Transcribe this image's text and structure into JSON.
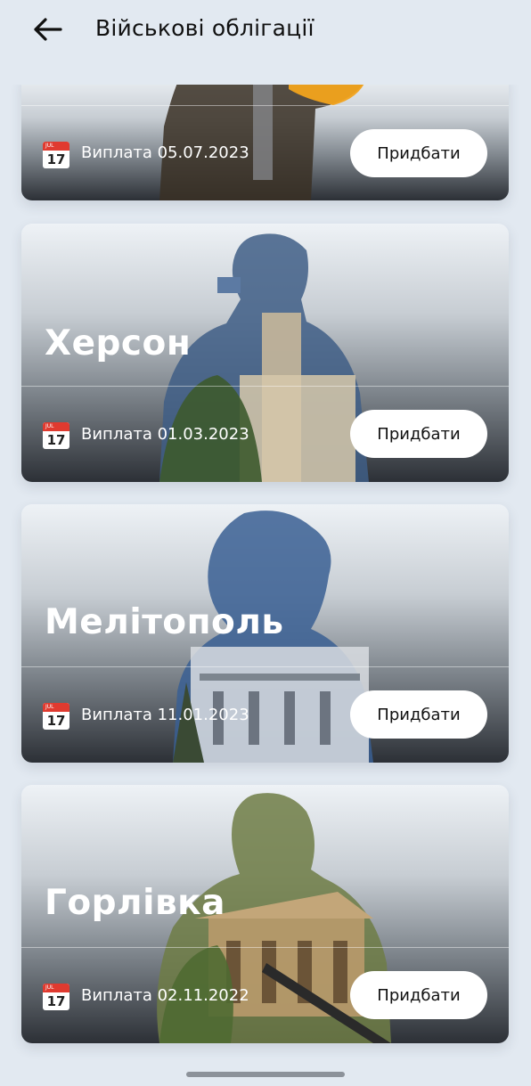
{
  "header": {
    "title": "Військові облігації",
    "back_icon": "arrow-left-icon"
  },
  "cards": [
    {
      "city": "",
      "payout": "Виплата 05.07.2023",
      "button": "Придбати",
      "calendar_month": "JUL",
      "calendar_day": "17"
    },
    {
      "city": "Херсон",
      "payout": "Виплата 01.03.2023",
      "button": "Придбати",
      "calendar_month": "JUL",
      "calendar_day": "17"
    },
    {
      "city": "Мелітополь",
      "payout": "Виплата 11.01.2023",
      "button": "Придбати",
      "calendar_month": "JUL",
      "calendar_day": "17"
    },
    {
      "city": "Горлівка",
      "payout": "Виплата 02.11.2022",
      "button": "Придбати",
      "calendar_month": "JUL",
      "calendar_day": "17"
    }
  ],
  "colors": {
    "background": "#e2e9f1",
    "calendar_red": "#e03a2f",
    "button": "#ffffff"
  }
}
